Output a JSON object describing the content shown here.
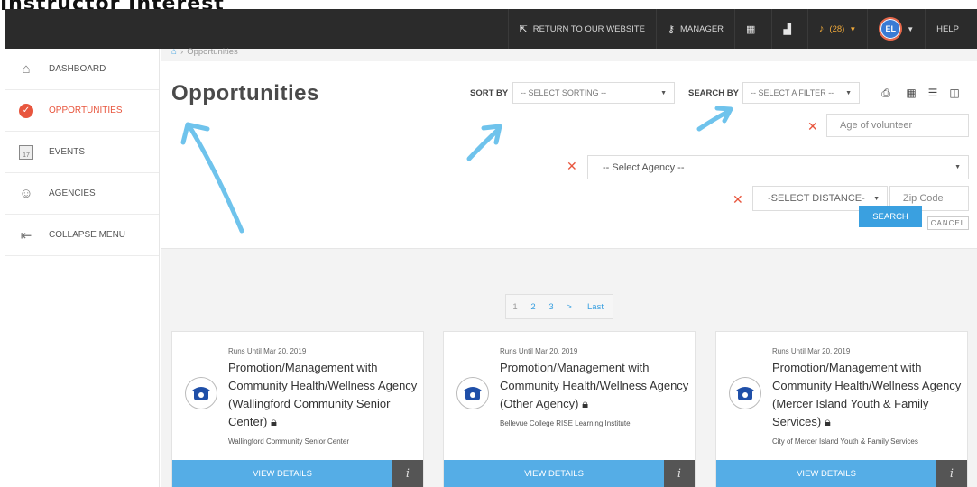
{
  "caption": "Instructor Interest",
  "topbar": {
    "return_label": "Return to our website",
    "manager_label": "Manager",
    "alerts_label": "(28)",
    "avatar_initials": "EL",
    "help_label": "Help"
  },
  "sidebar": {
    "items": [
      {
        "label": "Dashboard",
        "icon": "home-icon"
      },
      {
        "label": "Opportunities",
        "icon": "check-circle-icon"
      },
      {
        "label": "Events",
        "icon": "calendar-icon"
      },
      {
        "label": "Agencies",
        "icon": "agencies-icon"
      },
      {
        "label": "Collapse Menu",
        "icon": "collapse-icon"
      }
    ]
  },
  "breadcrumb": {
    "current": "Opportunities"
  },
  "page_title": "Opportunities",
  "filters": {
    "sort_by_label": "Sort By",
    "sort_placeholder": "-- SELECT SORTING --",
    "search_by_label": "Search By",
    "filter_placeholder": "-- SELECT A FILTER --",
    "age_placeholder": "Age of volunteer",
    "agency_placeholder": "-- Select Agency --",
    "distance_placeholder": "-SELECT DISTANCE-",
    "zip_placeholder": "Zip Code",
    "search_label": "Search",
    "cancel_label": "Cancel"
  },
  "pagination": {
    "pages": [
      "1",
      "2",
      "3"
    ],
    "next": ">",
    "last": "Last"
  },
  "cards": [
    {
      "date": "Runs Until Mar 20, 2019",
      "title": "Promotion/Management with Community Health/Wellness Agency (Wallingford Community Senior Center)",
      "agency": "Wallingford Community Senior Center",
      "view_label": "View Details",
      "info_label": "i"
    },
    {
      "date": "Runs Until Mar 20, 2019",
      "title": "Promotion/Management with Community Health/Wellness Agency (Other Agency)",
      "agency": "Bellevue College RISE Learning Institute",
      "view_label": "View Details",
      "info_label": "i"
    },
    {
      "date": "Runs Until Mar 20, 2019",
      "title": "Promotion/Management with Community Health/Wellness Agency (Mercer Island Youth & Family Services)",
      "agency": "City of Mercer Island Youth & Family Services",
      "view_label": "View Details",
      "info_label": "i"
    }
  ],
  "colors": {
    "accent": "#3aa0e0",
    "active": "#e8563e",
    "topbar": "#2b2b2b",
    "annotation": "#6fc3ec"
  }
}
